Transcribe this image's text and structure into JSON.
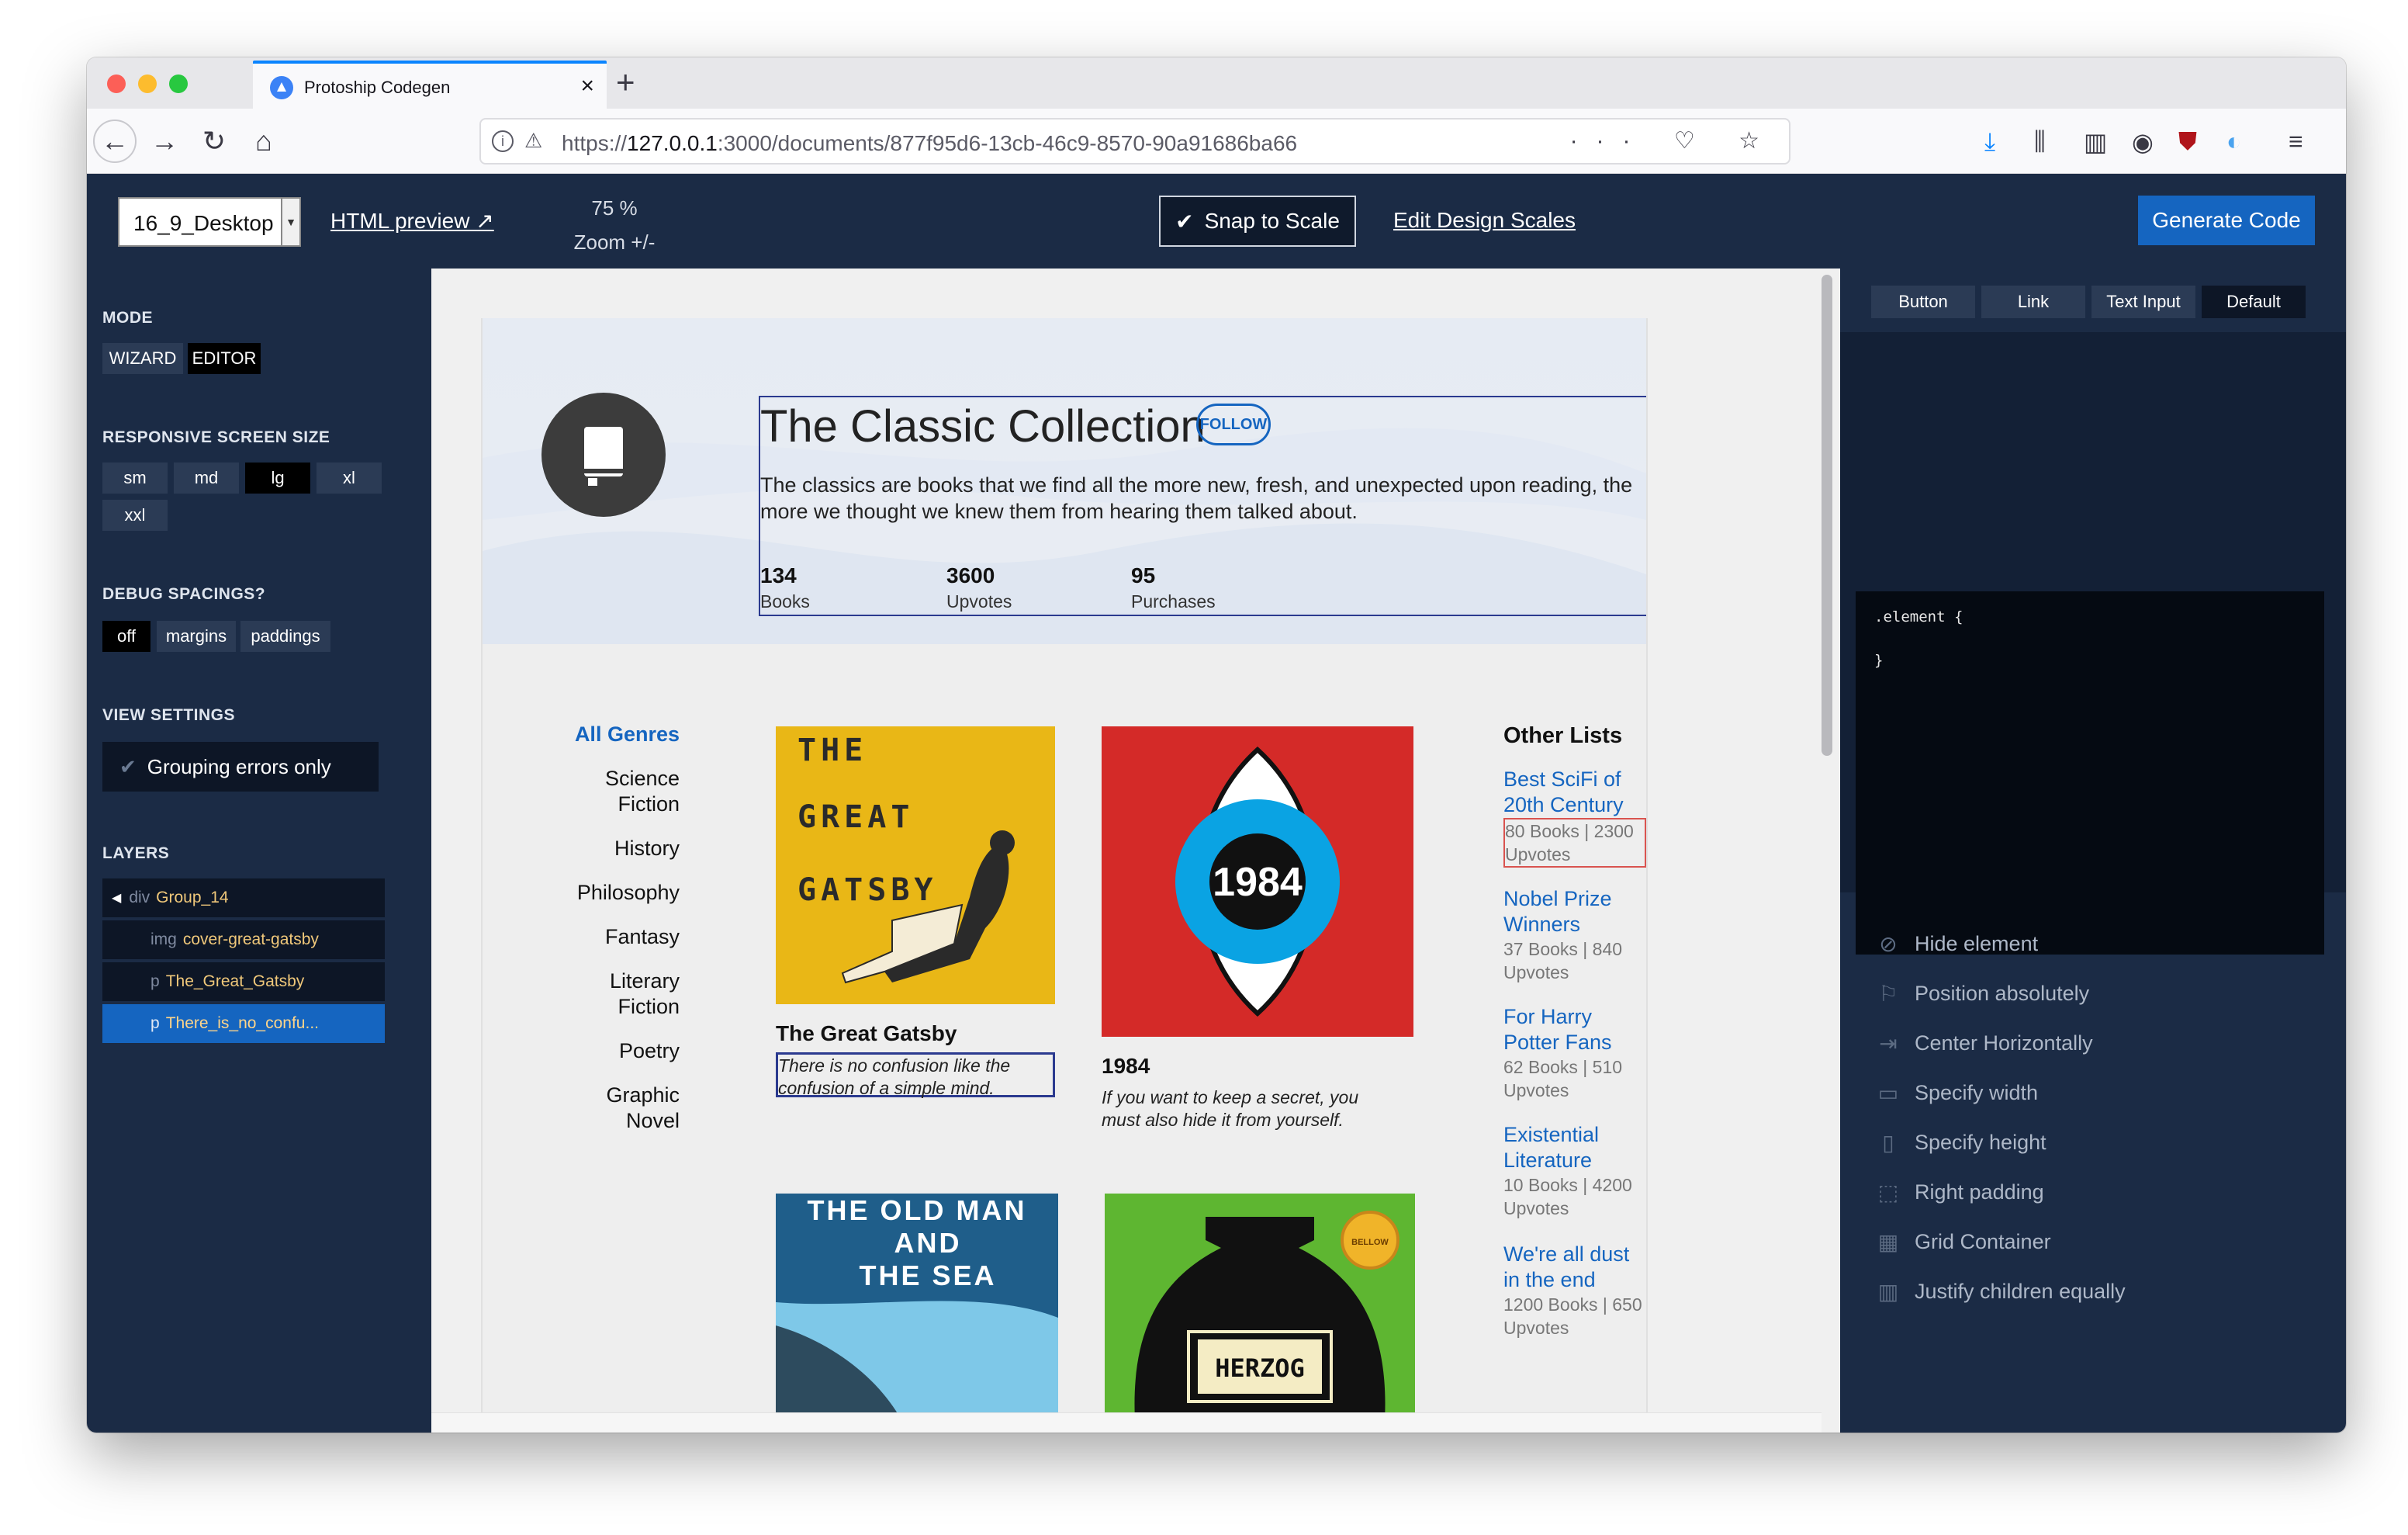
{
  "browser": {
    "tab_title": "Protoship Codegen",
    "close_glyph": "×",
    "new_tab_glyph": "+",
    "url_scheme": "https://",
    "url_host": "127.0.0.1",
    "url_path": ":3000/documents/877f95d6-13cb-46c9-8570-90a91686ba66",
    "url_actions": "··· ♡ ☆"
  },
  "toolbar": {
    "preset": "16_9_Desktop",
    "html_preview": "HTML preview",
    "zoom_value": "75 %",
    "zoom_label": "Zoom +/-",
    "snap_label": "Snap to Scale",
    "edit_scales": "Edit Design Scales",
    "generate": "Generate Code"
  },
  "left": {
    "mode_title": "MODE",
    "mode_options": [
      "WIZARD",
      "EDITOR"
    ],
    "mode_selected": "EDITOR",
    "screen_title": "RESPONSIVE SCREEN SIZE",
    "screen_sizes": [
      "sm",
      "md",
      "lg",
      "xl",
      "xxl"
    ],
    "screen_selected": "lg",
    "debug_title": "DEBUG SPACINGS?",
    "debug_options": [
      "off",
      "margins",
      "paddings"
    ],
    "debug_selected": "off",
    "view_title": "VIEW SETTINGS",
    "grouping": "Grouping errors only",
    "layers_title": "LAYERS",
    "layers": [
      {
        "tag": "div",
        "name": "Group_14"
      },
      {
        "tag": "img",
        "name": "cover-great-gatsby"
      },
      {
        "tag": "p",
        "name": "The_Great_Gatsby"
      },
      {
        "tag": "p",
        "name": "There_is_no_confu..."
      }
    ]
  },
  "page": {
    "title": "The Classic Collection",
    "follow": "FOLLOW",
    "description": "The classics are books that we find all the more new, fresh, and unexpected upon reading, the more we thought we knew them from hearing them talked about.",
    "stats": [
      {
        "value": "134",
        "label": "Books"
      },
      {
        "value": "3600",
        "label": "Upvotes"
      },
      {
        "value": "95",
        "label": "Purchases"
      }
    ],
    "genres": [
      "All Genres",
      "Science Fiction",
      "History",
      "Philosophy",
      "Fantasy",
      "Literary Fiction",
      "Poetry",
      "Graphic Novel"
    ],
    "books": [
      {
        "title": "The Great Gatsby",
        "quote": "There is no confusion like the confusion of a simple mind.",
        "cover_text": [
          "THE",
          "GREAT",
          "GATSBY"
        ]
      },
      {
        "title": "1984",
        "quote": "If you want to keep a secret, you must also hide it from yourself.",
        "cover_text": "1984"
      },
      {
        "cover_text": [
          "THE OLD MAN",
          "AND",
          "THE SEA"
        ]
      },
      {
        "cover_text": "HERZOG",
        "badge": "BELLOW"
      }
    ],
    "other_lists_title": "Other Lists",
    "other_lists": [
      {
        "name": "Best SciFi of 20th Century",
        "meta": "80 Books | 2300 Upvotes"
      },
      {
        "name": "Nobel Prize Winners",
        "meta": "37 Books | 840 Upvotes"
      },
      {
        "name": "For Harry Potter Fans",
        "meta": "62 Books | 510 Upvotes"
      },
      {
        "name": "Existential Literature",
        "meta": "10 Books | 4200 Upvotes"
      },
      {
        "name": "We're all dust in the end",
        "meta": "1200 Books | 650 Upvotes"
      }
    ]
  },
  "right": {
    "tabs": [
      "Button",
      "Link",
      "Text Input",
      "Default"
    ],
    "tab_selected": "Default",
    "code_open": ".element {",
    "code_close": "}",
    "properties": [
      {
        "label": "Hide element",
        "icon": "eye-slash-icon"
      },
      {
        "label": "Position absolutely",
        "icon": "flag-icon"
      },
      {
        "label": "Center Horizontally",
        "icon": "center-horizontal-icon"
      },
      {
        "label": "Specify width",
        "icon": "width-icon"
      },
      {
        "label": "Specify height",
        "icon": "height-icon"
      },
      {
        "label": "Right padding",
        "icon": "padding-icon"
      },
      {
        "label": "Grid Container",
        "icon": "grid-icon"
      },
      {
        "label": "Justify children equally",
        "icon": "columns-icon"
      }
    ]
  },
  "colors": {
    "app_bg": "#1b2b45",
    "accent": "#1565c0",
    "gatsby_cover": "#e9b716",
    "cover_1984": "#d42a28",
    "cover_1984_eye": "#0aa3e3",
    "cover_old_man": "#1f5e8a",
    "cover_herzog": "#5eb631"
  }
}
